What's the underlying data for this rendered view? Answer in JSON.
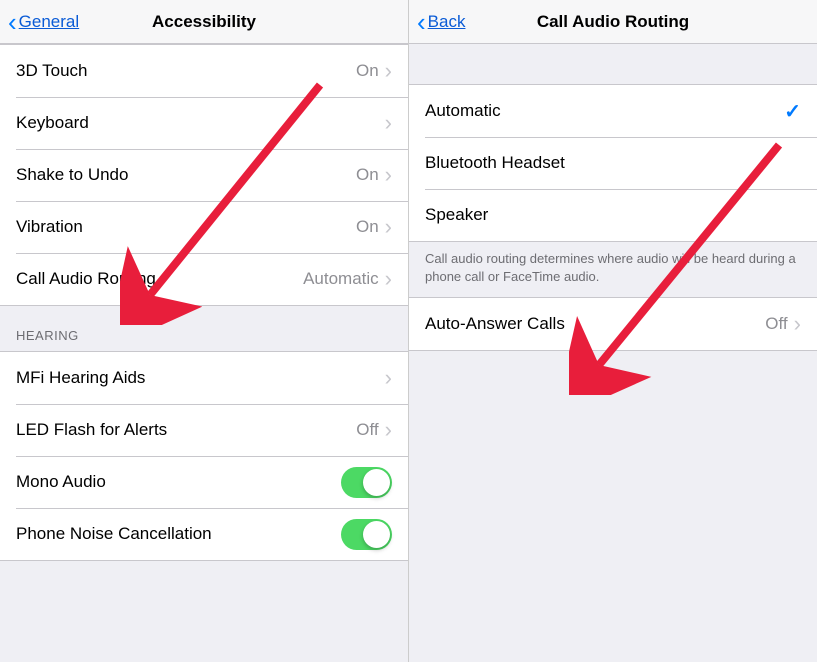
{
  "left": {
    "back_label": "General",
    "title": "Accessibility",
    "group1": [
      {
        "label": "3D Touch",
        "value": "On",
        "chevron": true
      },
      {
        "label": "Keyboard",
        "value": "",
        "chevron": true
      },
      {
        "label": "Shake to Undo",
        "value": "On",
        "chevron": true
      },
      {
        "label": "Vibration",
        "value": "On",
        "chevron": true
      },
      {
        "label": "Call Audio Routing",
        "value": "Automatic",
        "chevron": true
      }
    ],
    "section2_header": "HEARING",
    "group2": [
      {
        "label": "MFi Hearing Aids",
        "value": "",
        "chevron": true
      },
      {
        "label": "LED Flash for Alerts",
        "value": "Off",
        "chevron": true
      },
      {
        "label": "Mono Audio",
        "toggle": true
      },
      {
        "label": "Phone Noise Cancellation",
        "toggle": true
      }
    ]
  },
  "right": {
    "back_label": "Back",
    "title": "Call Audio Routing",
    "group1": [
      {
        "label": "Automatic",
        "checked": true
      },
      {
        "label": "Bluetooth Headset"
      },
      {
        "label": "Speaker"
      }
    ],
    "footer": "Call audio routing determines where audio will be heard during a phone call or FaceTime audio.",
    "group2": [
      {
        "label": "Auto-Answer Calls",
        "value": "Off",
        "chevron": true
      }
    ]
  }
}
